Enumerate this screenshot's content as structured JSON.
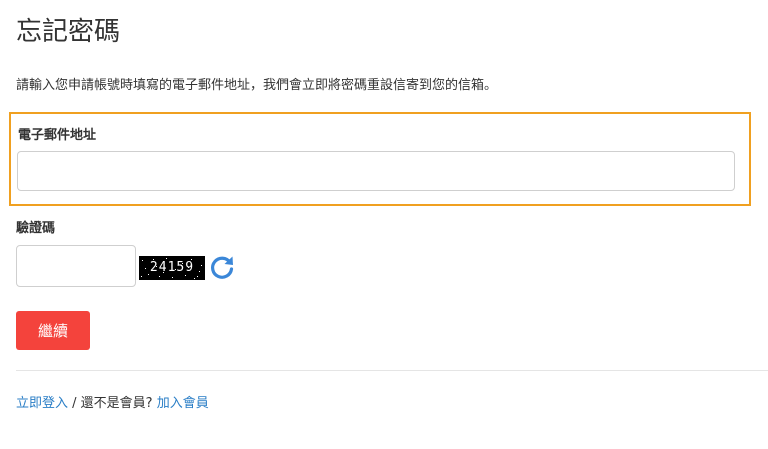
{
  "page": {
    "title": "忘記密碼",
    "instructions": "請輸入您申請帳號時填寫的電子郵件地址，我們會立即將密碼重設信寄到您的信箱。"
  },
  "form": {
    "email_label": "電子郵件地址",
    "email_value": "",
    "email_placeholder": "",
    "captcha_label": "驗證碼",
    "captcha_value": "",
    "captcha_placeholder": "",
    "captcha_image_text": "24159",
    "refresh_icon": "refresh-icon",
    "continue_label": "繼續"
  },
  "footer": {
    "login_link": "立即登入",
    "separator": " / ",
    "not_member_text": "還不是會員? ",
    "join_link": "加入會員"
  },
  "colors": {
    "accent_button": "#f4433c",
    "focus_border": "#f0a020",
    "link": "#2a7ec6",
    "refresh_icon": "#3b87d8"
  }
}
